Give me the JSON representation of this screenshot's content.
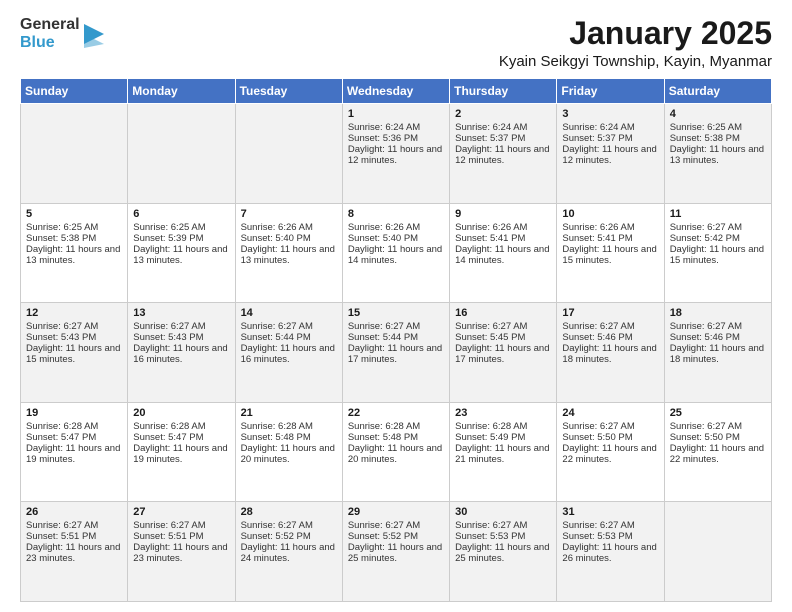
{
  "logo": {
    "line1": "General",
    "line2": "Blue"
  },
  "title": "January 2025",
  "location": "Kyain Seikgyi Township, Kayin, Myanmar",
  "days_header": [
    "Sunday",
    "Monday",
    "Tuesday",
    "Wednesday",
    "Thursday",
    "Friday",
    "Saturday"
  ],
  "weeks": [
    [
      {
        "day": "",
        "sunrise": "",
        "sunset": "",
        "daylight": ""
      },
      {
        "day": "",
        "sunrise": "",
        "sunset": "",
        "daylight": ""
      },
      {
        "day": "",
        "sunrise": "",
        "sunset": "",
        "daylight": ""
      },
      {
        "day": "1",
        "sunrise": "Sunrise: 6:24 AM",
        "sunset": "Sunset: 5:36 PM",
        "daylight": "Daylight: 11 hours and 12 minutes."
      },
      {
        "day": "2",
        "sunrise": "Sunrise: 6:24 AM",
        "sunset": "Sunset: 5:37 PM",
        "daylight": "Daylight: 11 hours and 12 minutes."
      },
      {
        "day": "3",
        "sunrise": "Sunrise: 6:24 AM",
        "sunset": "Sunset: 5:37 PM",
        "daylight": "Daylight: 11 hours and 12 minutes."
      },
      {
        "day": "4",
        "sunrise": "Sunrise: 6:25 AM",
        "sunset": "Sunset: 5:38 PM",
        "daylight": "Daylight: 11 hours and 13 minutes."
      }
    ],
    [
      {
        "day": "5",
        "sunrise": "Sunrise: 6:25 AM",
        "sunset": "Sunset: 5:38 PM",
        "daylight": "Daylight: 11 hours and 13 minutes."
      },
      {
        "day": "6",
        "sunrise": "Sunrise: 6:25 AM",
        "sunset": "Sunset: 5:39 PM",
        "daylight": "Daylight: 11 hours and 13 minutes."
      },
      {
        "day": "7",
        "sunrise": "Sunrise: 6:26 AM",
        "sunset": "Sunset: 5:40 PM",
        "daylight": "Daylight: 11 hours and 13 minutes."
      },
      {
        "day": "8",
        "sunrise": "Sunrise: 6:26 AM",
        "sunset": "Sunset: 5:40 PM",
        "daylight": "Daylight: 11 hours and 14 minutes."
      },
      {
        "day": "9",
        "sunrise": "Sunrise: 6:26 AM",
        "sunset": "Sunset: 5:41 PM",
        "daylight": "Daylight: 11 hours and 14 minutes."
      },
      {
        "day": "10",
        "sunrise": "Sunrise: 6:26 AM",
        "sunset": "Sunset: 5:41 PM",
        "daylight": "Daylight: 11 hours and 15 minutes."
      },
      {
        "day": "11",
        "sunrise": "Sunrise: 6:27 AM",
        "sunset": "Sunset: 5:42 PM",
        "daylight": "Daylight: 11 hours and 15 minutes."
      }
    ],
    [
      {
        "day": "12",
        "sunrise": "Sunrise: 6:27 AM",
        "sunset": "Sunset: 5:43 PM",
        "daylight": "Daylight: 11 hours and 15 minutes."
      },
      {
        "day": "13",
        "sunrise": "Sunrise: 6:27 AM",
        "sunset": "Sunset: 5:43 PM",
        "daylight": "Daylight: 11 hours and 16 minutes."
      },
      {
        "day": "14",
        "sunrise": "Sunrise: 6:27 AM",
        "sunset": "Sunset: 5:44 PM",
        "daylight": "Daylight: 11 hours and 16 minutes."
      },
      {
        "day": "15",
        "sunrise": "Sunrise: 6:27 AM",
        "sunset": "Sunset: 5:44 PM",
        "daylight": "Daylight: 11 hours and 17 minutes."
      },
      {
        "day": "16",
        "sunrise": "Sunrise: 6:27 AM",
        "sunset": "Sunset: 5:45 PM",
        "daylight": "Daylight: 11 hours and 17 minutes."
      },
      {
        "day": "17",
        "sunrise": "Sunrise: 6:27 AM",
        "sunset": "Sunset: 5:46 PM",
        "daylight": "Daylight: 11 hours and 18 minutes."
      },
      {
        "day": "18",
        "sunrise": "Sunrise: 6:27 AM",
        "sunset": "Sunset: 5:46 PM",
        "daylight": "Daylight: 11 hours and 18 minutes."
      }
    ],
    [
      {
        "day": "19",
        "sunrise": "Sunrise: 6:28 AM",
        "sunset": "Sunset: 5:47 PM",
        "daylight": "Daylight: 11 hours and 19 minutes."
      },
      {
        "day": "20",
        "sunrise": "Sunrise: 6:28 AM",
        "sunset": "Sunset: 5:47 PM",
        "daylight": "Daylight: 11 hours and 19 minutes."
      },
      {
        "day": "21",
        "sunrise": "Sunrise: 6:28 AM",
        "sunset": "Sunset: 5:48 PM",
        "daylight": "Daylight: 11 hours and 20 minutes."
      },
      {
        "day": "22",
        "sunrise": "Sunrise: 6:28 AM",
        "sunset": "Sunset: 5:48 PM",
        "daylight": "Daylight: 11 hours and 20 minutes."
      },
      {
        "day": "23",
        "sunrise": "Sunrise: 6:28 AM",
        "sunset": "Sunset: 5:49 PM",
        "daylight": "Daylight: 11 hours and 21 minutes."
      },
      {
        "day": "24",
        "sunrise": "Sunrise: 6:27 AM",
        "sunset": "Sunset: 5:50 PM",
        "daylight": "Daylight: 11 hours and 22 minutes."
      },
      {
        "day": "25",
        "sunrise": "Sunrise: 6:27 AM",
        "sunset": "Sunset: 5:50 PM",
        "daylight": "Daylight: 11 hours and 22 minutes."
      }
    ],
    [
      {
        "day": "26",
        "sunrise": "Sunrise: 6:27 AM",
        "sunset": "Sunset: 5:51 PM",
        "daylight": "Daylight: 11 hours and 23 minutes."
      },
      {
        "day": "27",
        "sunrise": "Sunrise: 6:27 AM",
        "sunset": "Sunset: 5:51 PM",
        "daylight": "Daylight: 11 hours and 23 minutes."
      },
      {
        "day": "28",
        "sunrise": "Sunrise: 6:27 AM",
        "sunset": "Sunset: 5:52 PM",
        "daylight": "Daylight: 11 hours and 24 minutes."
      },
      {
        "day": "29",
        "sunrise": "Sunrise: 6:27 AM",
        "sunset": "Sunset: 5:52 PM",
        "daylight": "Daylight: 11 hours and 25 minutes."
      },
      {
        "day": "30",
        "sunrise": "Sunrise: 6:27 AM",
        "sunset": "Sunset: 5:53 PM",
        "daylight": "Daylight: 11 hours and 25 minutes."
      },
      {
        "day": "31",
        "sunrise": "Sunrise: 6:27 AM",
        "sunset": "Sunset: 5:53 PM",
        "daylight": "Daylight: 11 hours and 26 minutes."
      },
      {
        "day": "",
        "sunrise": "",
        "sunset": "",
        "daylight": ""
      }
    ]
  ]
}
